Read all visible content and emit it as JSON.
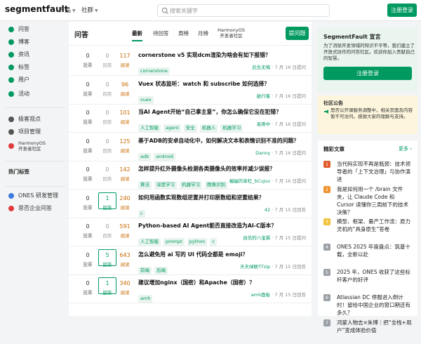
{
  "brand": {
    "logo_prefix": "segment",
    "logo_suffix": "fault",
    "accent": "#009a61"
  },
  "topnav": {
    "products": "产品",
    "community": "社群",
    "search_placeholder": "搜索关键字",
    "login_button": "注册登录"
  },
  "sidebar": {
    "items": [
      {
        "label": "问答",
        "color": "#009a61"
      },
      {
        "label": "博客",
        "color": "#009a61"
      },
      {
        "label": "资讯",
        "color": "#009a61"
      },
      {
        "label": "标签",
        "color": "#009a61"
      },
      {
        "label": "用户",
        "color": "#009a61"
      },
      {
        "label": "活动",
        "color": "#009a61"
      }
    ],
    "secondary": [
      {
        "label": "极客观点",
        "color": "#555"
      },
      {
        "label": "项目管理",
        "color": "#555"
      },
      {
        "label": "HarmonyOS",
        "sub": "开发者社区",
        "color": "#e03a3a"
      }
    ],
    "hot_tags": "热门标签",
    "bottom": [
      {
        "label": "ONES 研发管理",
        "color": "#3a7be0"
      },
      {
        "label": "思否企业问答",
        "color": "#e03a3a"
      }
    ]
  },
  "main": {
    "title": "问答",
    "tabs": [
      "最新",
      "待回答",
      "周榜",
      "月榜",
      "HarmonyOS",
      "开发者社区"
    ],
    "ask_button": "提问题",
    "vote_label": "投票",
    "answer_label": "回答",
    "view_label": "阅读",
    "questions": [
      {
        "votes": "0",
        "answers": "0",
        "views": "117",
        "title": "cornerstone v5 实现dcm渲染为啥会有如下报错？",
        "tags": [
          "cornerstone"
        ],
        "user": "此生无悔",
        "time": " · 7 月 16 日提问",
        "has_answer": false
      },
      {
        "votes": "0",
        "answers": "0",
        "views": "96",
        "title": "Vuex 状态监听：watch 和 subscribe 如何选择？",
        "tags": [
          "vuex"
        ],
        "user": "敌行客",
        "time": " · 7 月 16 日提问",
        "has_answer": false
      },
      {
        "votes": "0",
        "answers": "0",
        "views": "101",
        "title": "当AI Agent开始“自己拿主意”，你怎么确保它没在犯错？",
        "tags": [
          "人工智能",
          "agent",
          "安全",
          "机器人",
          "机器学习"
        ],
        "user": "易用中",
        "time": " · 7 月 16 日提问",
        "has_answer": false
      },
      {
        "votes": "0",
        "answers": "0",
        "views": "125",
        "title": "基于ADB的安卓自动化中，如何解决文本和表情识别不准的问题？",
        "tags": [
          "adb",
          "android"
        ],
        "user": "Danny",
        "time": " · 7 月 16 日提问",
        "has_answer": false
      },
      {
        "votes": "0",
        "answers": "0",
        "views": "142",
        "title": "怎样提升红外摄像头检测各类摄像头的效率并减少误报？",
        "tags": [
          "算法",
          "深度学习",
          "机器学习",
          "图像识别"
        ],
        "user": "蝙蝠的单杠_bCuJuv",
        "time": " · 7 月 16 日提问",
        "has_answer": false
      },
      {
        "votes": "0",
        "answers": "1",
        "views": "240",
        "title": "如何用函数实现数组逆置并打印原数组和逆置结果？",
        "tags": [
          "c"
        ],
        "user": "42",
        "time": " · 7 月 15 日回答",
        "has_answer": true
      },
      {
        "votes": "0",
        "answers": "0",
        "views": "591",
        "title": "Python-based AI Agent能否直接改造为AI-C版本？",
        "tags": [
          "人工智能",
          "prompt",
          "python",
          "c"
        ],
        "user": "自信的八宝粥",
        "time": " · 7 月 15 日提问",
        "has_answer": false
      },
      {
        "votes": "0",
        "answers": "5",
        "views": "643",
        "title": "怎么避免用 ai 写的 UI 代码全都是 emoji？",
        "tags": [
          "前端",
          "后端"
        ],
        "user": "天天绿联TTzip",
        "time": " · 7 月 15 日回答",
        "has_answer": true
      },
      {
        "votes": "0",
        "answers": "1",
        "views": "340",
        "title": "建议增加nginx（国密）和Apache（国密）？",
        "tags": [
          "amh"
        ],
        "user": "amh面板",
        "time": " · 7 月 15 日回答",
        "has_answer": true
      }
    ]
  },
  "right": {
    "welcome_title": "SegmentFault 宣言",
    "welcome_text": "为了消除开发领域的知识不平等，我们建立了开放式协作的问答社区。欢迎你加入贡献自己的智慧。",
    "welcome_button": "注册登录",
    "notice_title": "社区公告",
    "notice_text": "思否公开课服务调整中，相关页面及内容暂不可访问。感谢大家的理解与支持。",
    "articles_title": "精彩文章",
    "articles_more": "更多",
    "articles": [
      {
        "num": "1",
        "title": "当代码实现不再是瓶颈：技术领导者的「上下文治理」与协作演进",
        "color": "#e05a2b"
      },
      {
        "num": "2",
        "title": "我是如何用一个 /brain 文件夹，让 Claude Code 和 Cursor 读懂你三周前下的技术决策？",
        "color": "#f0922d"
      },
      {
        "num": "3",
        "title": "模型、框架、量产工作流：原力灵机的“具身原生”答卷",
        "color": "#f3c13a"
      },
      {
        "num": "4",
        "title": "ONES 2025 年度盘点：筑基十载，全新以赴",
        "color": "#9aa0a6"
      },
      {
        "num": "5",
        "title": "2025 年，ONES 收获了这些标杆客户的好评",
        "color": "#9aa0a6"
      },
      {
        "num": "6",
        "title": "Atlassian DC 停服进入倒计时！留给中国企业的窗口期还有多久？",
        "color": "#9aa0a6"
      },
      {
        "num": "7",
        "title": "鸿蒙人物志×朱博｜把“全栈+用户”变成体验价值",
        "color": "#9aa0a6"
      }
    ]
  }
}
